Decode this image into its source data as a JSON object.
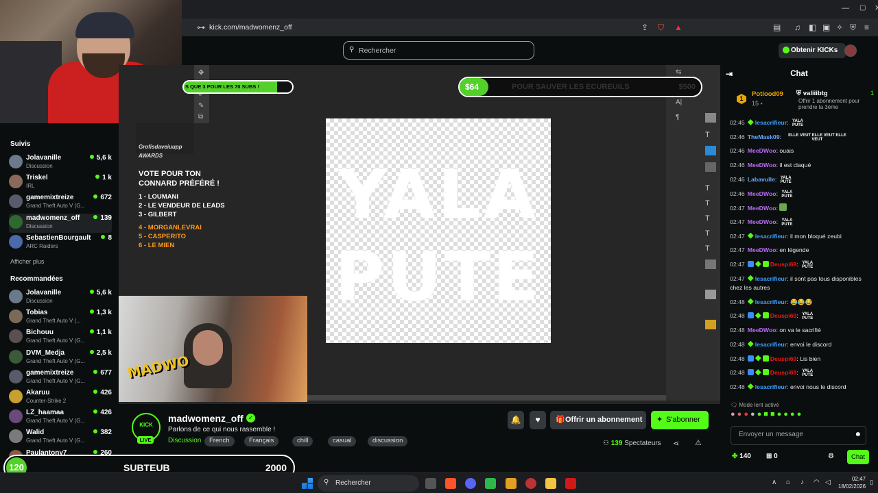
{
  "browser": {
    "url": "kick.com/madwomenz_off"
  },
  "kick_nav": {
    "search_placeholder": "Rechercher",
    "get_kicks": "Obtenir KICKs"
  },
  "sidebar": {
    "followed_heading": "Suivis",
    "followed": [
      {
        "name": "Jolavanille",
        "sub": "Discussion",
        "count": "5,6 k",
        "live": true,
        "color": "#6a7a8a"
      },
      {
        "name": "Triskel",
        "sub": "IRL",
        "count": "1 k",
        "live": true,
        "color": "#8a6a5a"
      },
      {
        "name": "gamemixtreize",
        "sub": "Grand Theft Auto V (G...",
        "count": "672",
        "live": true,
        "color": "#5a5a6a"
      },
      {
        "name": "madwomenz_off",
        "sub": "Discussion",
        "count": "139",
        "live": true,
        "color": "#2e6a2e"
      },
      {
        "name": "SebastienBourgault",
        "sub": "ARC Raiders",
        "count": "8",
        "live": true,
        "color": "#4a6aaa"
      }
    ],
    "show_more": "Afficher plus",
    "recommended_heading": "Recommandées",
    "recommended": [
      {
        "name": "Jolavanille",
        "sub": "Discussion",
        "count": "5,6 k",
        "live": true,
        "color": "#6a7a8a"
      },
      {
        "name": "Tobias",
        "sub": "Grand Theft Auto V (...",
        "count": "1,3 k",
        "live": true,
        "color": "#7a6a5a"
      },
      {
        "name": "Bichouu",
        "sub": "Grand Theft Auto V (G...",
        "count": "1,1 k",
        "live": true,
        "color": "#5a5050"
      },
      {
        "name": "DVM_Medja",
        "sub": "Grand Theft Auto V (G...",
        "count": "2,5 k",
        "live": true,
        "color": "#3a5a3a"
      },
      {
        "name": "gamemixtreize",
        "sub": "Grand Theft Auto V (G...",
        "count": "677",
        "live": true,
        "color": "#5a5a6a"
      },
      {
        "name": "Akaruu",
        "sub": "Counter-Strike 2",
        "count": "426",
        "live": true,
        "color": "#c8a030"
      },
      {
        "name": "LZ_haamaa",
        "sub": "Grand Theft Auto V (G...",
        "count": "426",
        "live": true,
        "color": "#6a4a7a"
      },
      {
        "name": "Walid",
        "sub": "Grand Theft Auto V (G...",
        "count": "382",
        "live": true,
        "color": "#7a7a7a"
      },
      {
        "name": "Paulantony7",
        "sub": "Discussion",
        "count": "260",
        "live": true,
        "color": "#8a5a4a"
      }
    ]
  },
  "stream_overlay": {
    "goal_left_text": "S QUE 3 POUR LES 70 SUBS !",
    "goal_left_progress": 0.86,
    "goal_right_amount": "$64",
    "goal_right_text": "POUR SAUVER LES ECUREUILS",
    "goal_right_target": "$500",
    "awards_logo": "Grofisdaveiuupp AWARDS",
    "awards_title_1": "VOTE POUR TON",
    "awards_title_2": "CONNARD PRÉFÉRÉ !",
    "awards_list": [
      "1 - LOUMANI",
      "2 - LE VENDEUR DE LEADS",
      "3 - GILBERT"
    ],
    "awards_list_orange": [
      "4 - MORGANLEVRAI",
      "5 - CASPERITO",
      "6 - LE MIEN"
    ],
    "canvas_line1": "YALA",
    "canvas_line2": "PUTE",
    "cam2_logo": "MADWO"
  },
  "channel": {
    "avatar_text": "KICK",
    "live_badge": "LIVE",
    "name": "madwomenz_off",
    "title": "Parlons de ce qui nous rassemble !",
    "category": "Discussion",
    "tags": [
      "French",
      "Français",
      "chill",
      "casual",
      "discussion"
    ],
    "gift_sub": "Offrir un abonnement",
    "subscribe": "S'abonner",
    "viewers": "139",
    "viewers_label": "Spectateurs"
  },
  "subteub": {
    "count": "120",
    "name": "SUBTEUB",
    "goal": "2000"
  },
  "chat": {
    "heading": "Chat",
    "pinned": {
      "user1": "Potlood09",
      "user1_count": "15",
      "user2": "valiiibtg",
      "user2_count": "1",
      "user2_text": "Offrir 1 abonnement pour prendre la 3ème"
    },
    "messages": [
      {
        "time": "02:45",
        "user": "lesacrifieur",
        "color": "#3aa0ff",
        "badge": "green",
        "text": "",
        "emote": "YALA PUTE"
      },
      {
        "time": "02:46",
        "user": "TheMask09",
        "color": "#6aa8ff",
        "badge": "",
        "text": "",
        "emote": "ELLE VEUT ELLE VEUT ELLE VEUT"
      },
      {
        "time": "02:46",
        "user": "MeeDWoo",
        "color": "#b86cf2",
        "badge": "",
        "text": "ouais",
        "emote": ""
      },
      {
        "time": "02:46",
        "user": "MeeDWoo",
        "color": "#b86cf2",
        "badge": "",
        "text": "il est claqué",
        "emote": ""
      },
      {
        "time": "02:46",
        "user": "Labavulle",
        "color": "#6aa8ff",
        "badge": "",
        "text": "",
        "emote": "YALA PUTE"
      },
      {
        "time": "02:46",
        "user": "MeeDWoo",
        "color": "#b86cf2",
        "badge": "",
        "text": "",
        "emote": "YALA PUTE"
      },
      {
        "time": "02:47",
        "user": "MeeDWoo",
        "color": "#b86cf2",
        "badge": "",
        "text": "",
        "emote": "icon"
      },
      {
        "time": "02:47",
        "user": "MeeDWoo",
        "color": "#b86cf2",
        "badge": "",
        "text": "",
        "emote": "YALA PUTE"
      },
      {
        "time": "02:47",
        "user": "lesacrifieur",
        "color": "#3aa0ff",
        "badge": "green",
        "text": "il mon bloqué zeubi",
        "emote": ""
      },
      {
        "time": "02:47",
        "user": "MeeDWoo",
        "color": "#b86cf2",
        "badge": "",
        "text": "en légende",
        "emote": ""
      },
      {
        "time": "02:47",
        "user": "Deuspi69",
        "color": "#e91916",
        "badge": "multi",
        "text": "",
        "emote": "YALA PUTE"
      },
      {
        "time": "02:47",
        "user": "lesacrifieur",
        "color": "#3aa0ff",
        "badge": "green",
        "text": "il sont pas tous disponibles chez les autres",
        "emote": ""
      },
      {
        "time": "02:48",
        "user": "lesacrifieur",
        "color": "#3aa0ff",
        "badge": "green",
        "text": "😂😂😂",
        "emote": ""
      },
      {
        "time": "02:48",
        "user": "Deuspi69",
        "color": "#e91916",
        "badge": "multi",
        "text": "",
        "emote": "YALA PUTE"
      },
      {
        "time": "02:48",
        "user": "MeeDWoo",
        "color": "#b86cf2",
        "badge": "",
        "text": "on va le sacrifié",
        "emote": ""
      },
      {
        "time": "02:48",
        "user": "lesacrifieur",
        "color": "#3aa0ff",
        "badge": "green",
        "text": "envoi le discord",
        "emote": ""
      },
      {
        "time": "02:48",
        "user": "Deuspi69",
        "color": "#e91916",
        "badge": "multi",
        "text": "Lis bien",
        "emote": ""
      },
      {
        "time": "02:48",
        "user": "Deuspi69",
        "color": "#e91916",
        "badge": "multi",
        "text": "",
        "emote": "YALA PUTE"
      },
      {
        "time": "02:48",
        "user": "lesacrifieur",
        "color": "#3aa0ff",
        "badge": "green",
        "text": "envoi nous le discord",
        "emote": ""
      }
    ],
    "slow_mode": "Mode lent activé",
    "input_placeholder": "Envoyer un message",
    "kicks_count": "140",
    "gift_count": "0",
    "send_button": "Chat"
  },
  "taskbar": {
    "search": "Rechercher",
    "time": "02:47",
    "date": "18/02/2026"
  }
}
